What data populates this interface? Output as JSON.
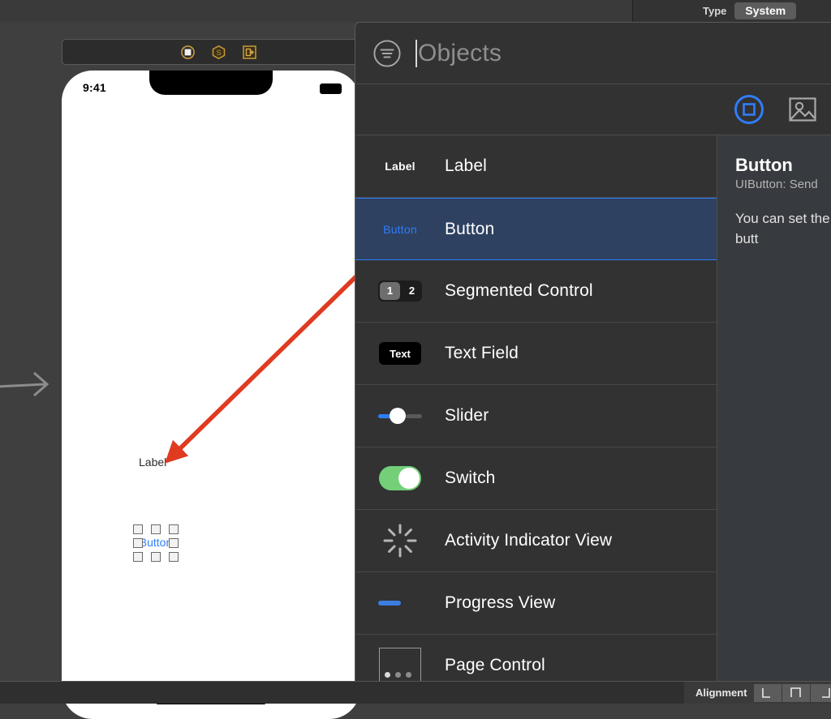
{
  "canvas": {
    "device_status_time": "9:41",
    "label_text": "Label",
    "button_text": "Button",
    "scene_dock_icons": [
      "view-controller-icon",
      "first-responder-icon",
      "exit-icon"
    ],
    "entry_arrow": "storyboard-entry-point-arrow",
    "annotation_arrow_color": "#e03a20"
  },
  "inspector": {
    "type_label": "Type",
    "type_value": "System"
  },
  "library": {
    "search": {
      "placeholder": "Objects",
      "value": "",
      "filter_icon": "filter-icon"
    },
    "tabs": [
      {
        "name": "objects-tab",
        "icon": "square-object-icon",
        "selected": true
      },
      {
        "name": "media-tab",
        "icon": "image-media-icon",
        "selected": false
      }
    ],
    "accent_color": "#2f7dfb",
    "selected_row_bg": "#2e4161",
    "items": [
      {
        "label": "Label",
        "icon": "label-icon",
        "selected": false
      },
      {
        "label": "Button",
        "icon": "button-icon",
        "selected": true
      },
      {
        "label": "Segmented Control",
        "icon": "segmented-control-icon",
        "selected": false,
        "segments": [
          "1",
          "2"
        ]
      },
      {
        "label": "Text Field",
        "icon": "text-field-icon",
        "selected": false,
        "icon_text": "Text"
      },
      {
        "label": "Slider",
        "icon": "slider-icon",
        "selected": false
      },
      {
        "label": "Switch",
        "icon": "switch-icon",
        "selected": false
      },
      {
        "label": "Activity Indicator View",
        "icon": "activity-indicator-icon",
        "selected": false
      },
      {
        "label": "Progress View",
        "icon": "progress-view-icon",
        "selected": false
      },
      {
        "label": "Page Control",
        "icon": "page-control-icon",
        "selected": false
      }
    ],
    "detail": {
      "title": "Button",
      "subtitle": "UIButton: Send",
      "description": "You can set the of a button. for each butt"
    }
  },
  "bottom_bar": {
    "alignment_label": "Alignment",
    "alignment_buttons": [
      "align-left-icon",
      "align-top-icon",
      "align-right-icon"
    ]
  }
}
